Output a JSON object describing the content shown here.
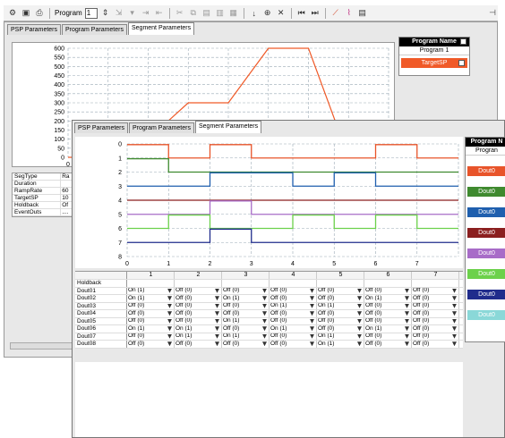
{
  "toolbar": {
    "program_label": "Program",
    "program_value": "1",
    "pin_icon": "pin"
  },
  "window_back": {
    "tabs": [
      "PSP Parameters",
      "Program Parameters",
      "Segment Parameters"
    ],
    "active_tab": 2,
    "legend": {
      "header": "Program Name",
      "program": "Program 1",
      "item": "TargetSP",
      "item_color": "#f05a28"
    },
    "properties": [
      {
        "key": "SegType",
        "value": "Ra"
      },
      {
        "key": "Duration",
        "value": ""
      },
      {
        "key": "RampRate",
        "value": "60"
      },
      {
        "key": "TargetSP",
        "value": "10"
      },
      {
        "key": "Holdback",
        "value": "Of"
      },
      {
        "key": "EventOuts",
        "value": "...."
      }
    ]
  },
  "chart_data": [
    {
      "type": "line",
      "title": "",
      "xlabel": "",
      "ylabel": "",
      "y_ticks": [
        "600",
        "550",
        "500",
        "450",
        "400",
        "350",
        "300",
        "250",
        "200",
        "150",
        "100",
        "50",
        "0"
      ],
      "x_ticks": [
        "0"
      ],
      "ylim": [
        0,
        600
      ],
      "grid": true,
      "series": [
        {
          "name": "TargetSP",
          "color": "#f05a28",
          "x": [
            0,
            1,
            2,
            3,
            4,
            5,
            6,
            7,
            8
          ],
          "values": [
            0,
            0,
            100,
            300,
            300,
            600,
            600,
            0,
            0
          ]
        }
      ]
    },
    {
      "type": "line",
      "title": "",
      "y_ticks": [
        "0",
        "1",
        "2",
        "3",
        "4",
        "5",
        "6",
        "7",
        "8"
      ],
      "x_ticks": [
        "0",
        "1",
        "2",
        "3",
        "4",
        "5",
        "6",
        "7"
      ],
      "grid": true,
      "series": [
        {
          "name": "Dout01",
          "color": "#e8542a",
          "base": 1,
          "states": [
            1,
            0,
            1,
            0,
            0,
            0,
            1,
            0
          ]
        },
        {
          "name": "Dout02",
          "color": "#3f8a2f",
          "base": 2,
          "states": [
            1,
            0,
            0,
            0,
            0,
            0,
            0,
            0
          ]
        },
        {
          "name": "Dout03",
          "color": "#1f5fae",
          "base": 3,
          "states": [
            0,
            0,
            1,
            1,
            0,
            1,
            0,
            0
          ]
        },
        {
          "name": "Dout04",
          "color": "#8b1f1f",
          "base": 4,
          "states": [
            0,
            0,
            0,
            0,
            0,
            0,
            0,
            0
          ]
        },
        {
          "name": "Dout05",
          "color": "#a86cc8",
          "base": 5,
          "states": [
            0,
            0,
            1,
            0,
            0,
            0,
            0,
            0
          ]
        },
        {
          "name": "Dout06",
          "color": "#6cd14b",
          "base": 6,
          "states": [
            0,
            1,
            0,
            0,
            1,
            0,
            1,
            0
          ]
        },
        {
          "name": "Dout07",
          "color": "#202c8c",
          "base": 7,
          "states": [
            0,
            0,
            1,
            0,
            0,
            0,
            0,
            0
          ]
        }
      ]
    }
  ],
  "window_front": {
    "tabs": [
      "PSP Parameters",
      "Program Parameters",
      "Segment Parameters"
    ],
    "active_tab": 2,
    "legend": {
      "header": "Program N",
      "program": "Progran",
      "items": [
        {
          "label": "Dout0",
          "color": "#e8542a"
        },
        {
          "label": "Dout0",
          "color": "#3f8a2f"
        },
        {
          "label": "Dout0",
          "color": "#1f5fae"
        },
        {
          "label": "Dout0",
          "color": "#8b1f1f"
        },
        {
          "label": "Dout0",
          "color": "#a86cc8"
        },
        {
          "label": "Dout0",
          "color": "#6cd14b"
        },
        {
          "label": "Dout0",
          "color": "#202c8c"
        },
        {
          "label": "Dout0",
          "color": "#8ad8d8"
        }
      ]
    },
    "table": {
      "columns": [
        "1",
        "2",
        "3",
        "4",
        "5",
        "6",
        "7"
      ],
      "rows": [
        {
          "label": "Holdback",
          "cells": [
            "",
            "",
            "",
            "",
            "",
            "",
            ""
          ]
        },
        {
          "label": "Dout01",
          "cells": [
            "On (1)",
            "Off (0)",
            "Off (0)",
            "Off (0)",
            "Off (0)",
            "Off (0)",
            "Off (0)"
          ]
        },
        {
          "label": "Dout02",
          "cells": [
            "On (1)",
            "Off (0)",
            "On (1)",
            "Off (0)",
            "Off (0)",
            "On (1)",
            "Off (0)"
          ]
        },
        {
          "label": "Dout03",
          "cells": [
            "Off (0)",
            "Off (0)",
            "Off (0)",
            "On (1)",
            "On (1)",
            "Off (0)",
            "Off (0)"
          ]
        },
        {
          "label": "Dout04",
          "cells": [
            "Off (0)",
            "Off (0)",
            "Off (0)",
            "Off (0)",
            "Off (0)",
            "Off (0)",
            "Off (0)"
          ]
        },
        {
          "label": "Dout05",
          "cells": [
            "Off (0)",
            "Off (0)",
            "On (1)",
            "Off (0)",
            "Off (0)",
            "Off (0)",
            "Off (0)"
          ]
        },
        {
          "label": "Dout06",
          "cells": [
            "On (1)",
            "On (1)",
            "Off (0)",
            "On (1)",
            "Off (0)",
            "On (1)",
            "Off (0)"
          ]
        },
        {
          "label": "Dout07",
          "cells": [
            "Off (0)",
            "On (1)",
            "On (1)",
            "Off (0)",
            "On (1)",
            "Off (0)",
            "Off (0)"
          ]
        },
        {
          "label": "Dout08",
          "cells": [
            "Off (0)",
            "Off (0)",
            "Off (0)",
            "Off (0)",
            "On (1)",
            "Off (0)",
            "Off (0)"
          ]
        }
      ]
    }
  }
}
